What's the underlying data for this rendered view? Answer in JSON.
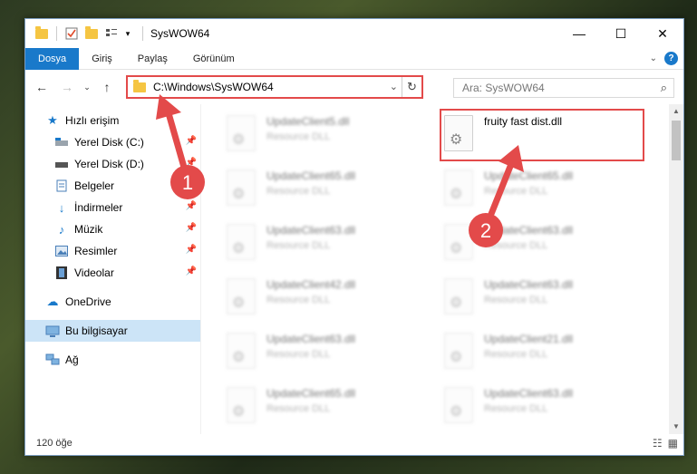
{
  "window": {
    "title": "SysWOW64",
    "controls": {
      "minimize": "—",
      "maximize": "☐",
      "close": "✕"
    }
  },
  "ribbon": {
    "tabs": [
      "Dosya",
      "Giriş",
      "Paylaş",
      "Görünüm"
    ],
    "expand_icon": "chevron-down-icon",
    "help": "?"
  },
  "address_bar": {
    "path": "C:\\Windows\\SysWOW64",
    "search_placeholder": "Ara: SysWOW64"
  },
  "sidebar": {
    "quick_access": "Hızlı erişim",
    "items": [
      {
        "label": "Yerel Disk (C:)",
        "pinned": true
      },
      {
        "label": "Yerel Disk (D:)",
        "pinned": true
      },
      {
        "label": "Belgeler",
        "pinned": true
      },
      {
        "label": "İndirmeler",
        "pinned": true
      },
      {
        "label": "Müzik",
        "pinned": true
      },
      {
        "label": "Resimler",
        "pinned": true
      },
      {
        "label": "Videolar",
        "pinned": true
      }
    ],
    "onedrive": "OneDrive",
    "this_pc": "Bu bilgisayar",
    "network": "Ağ"
  },
  "files": {
    "featured": {
      "name": "fruity fast dist.dll"
    },
    "left_column": [
      {
        "name": "UpdateClient5.dll",
        "type": "Resource DLL"
      },
      {
        "name": "UpdateClient65.dll",
        "type": "Resource DLL"
      },
      {
        "name": "UpdateClient63.dll",
        "type": "Resource DLL"
      },
      {
        "name": "UpdateClient42.dll",
        "type": "Resource DLL"
      },
      {
        "name": "UpdateClient63.dll",
        "type": "Resource DLL"
      },
      {
        "name": "UpdateClient65.dll",
        "type": "Resource DLL"
      }
    ],
    "right_column": [
      {
        "name": "UpdateClient65.dll",
        "type": "Resource DLL"
      },
      {
        "name": "UpdateClient63.dll",
        "type": "Resource DLL"
      },
      {
        "name": "UpdateClient63.dll",
        "type": "Resource DLL"
      },
      {
        "name": "UpdateClient21.dll",
        "type": "Resource DLL"
      },
      {
        "name": "UpdateClient63.dll",
        "type": "Resource DLL"
      }
    ]
  },
  "status_bar": {
    "item_count": "120 öğe"
  },
  "annotations": {
    "step1": "1",
    "step2": "2",
    "color": "#e34a4a"
  }
}
